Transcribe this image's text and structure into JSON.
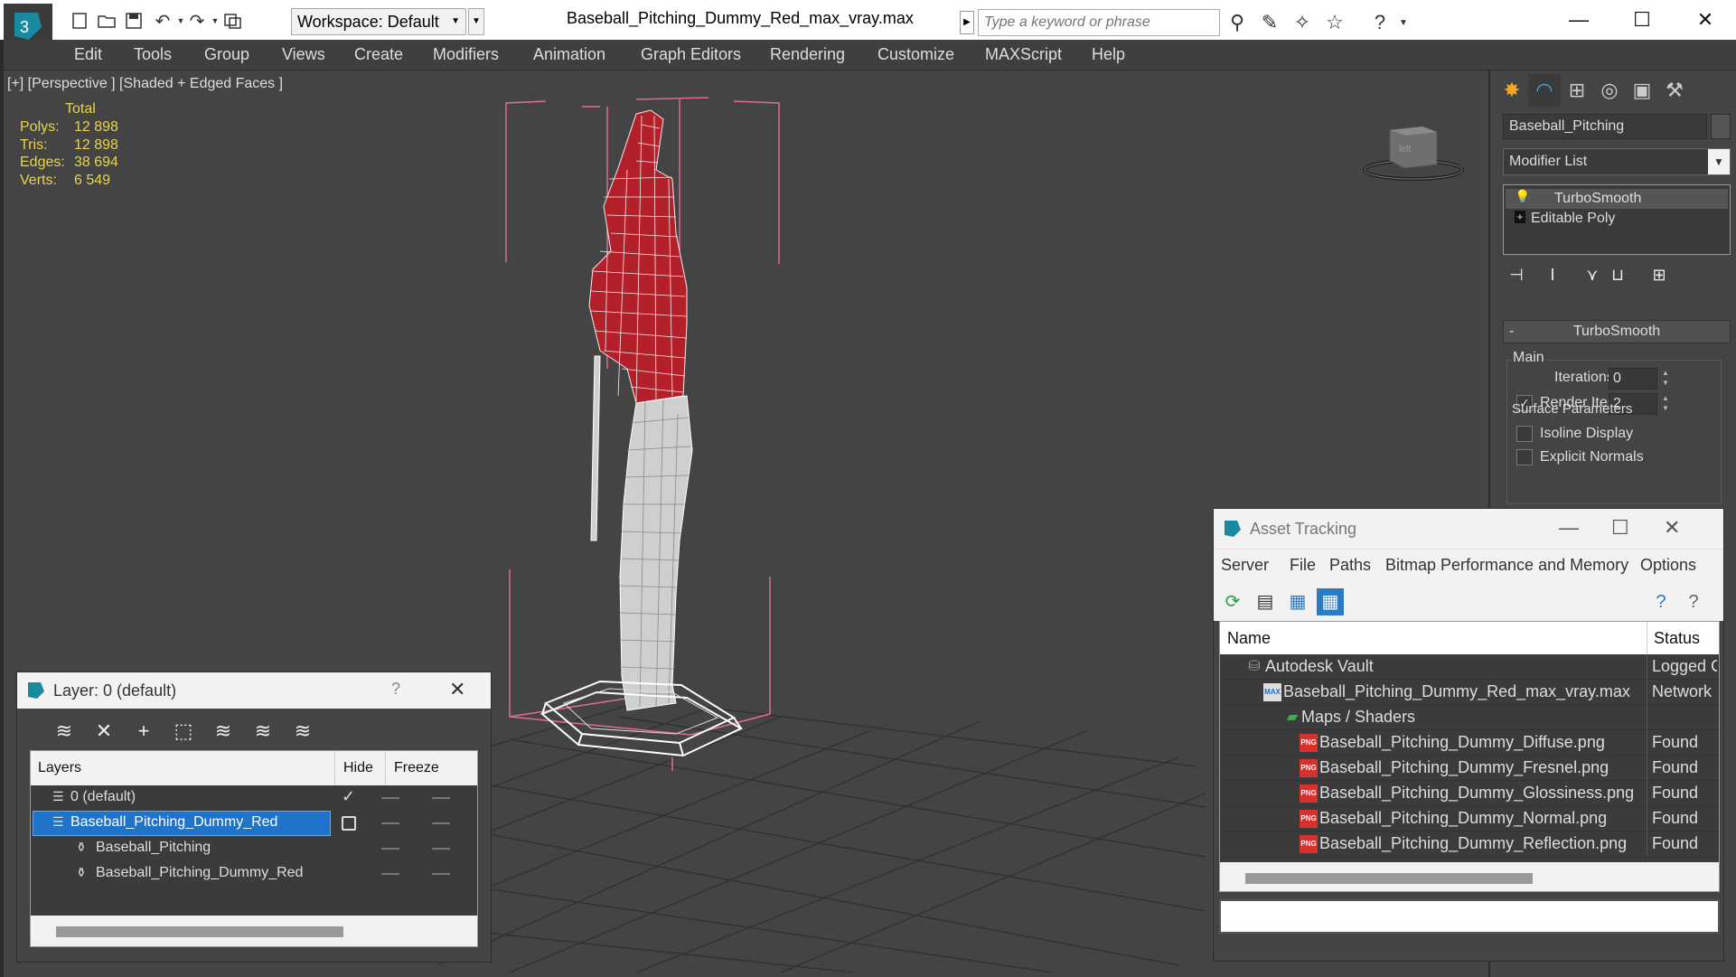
{
  "titlebar": {
    "workspace": "Workspace: Default",
    "window_title": "Baseball_Pitching_Dummy_Red_max_vray.max",
    "search_placeholder": "Type a keyword or phrase"
  },
  "menu": [
    "Edit",
    "Tools",
    "Group",
    "Views",
    "Create",
    "Modifiers",
    "Animation",
    "Graph Editors",
    "Rendering",
    "Customize",
    "MAXScript",
    "Help"
  ],
  "viewport": {
    "label": "[+] [Perspective ] [Shaded + Edged Faces ]",
    "viewcube_text": "left",
    "stats": {
      "header": "Total",
      "rows": [
        {
          "key": "Polys:",
          "value": "12 898"
        },
        {
          "key": "Tris:",
          "value": "12 898"
        },
        {
          "key": "Edges:",
          "value": "38 694"
        },
        {
          "key": "Verts:",
          "value": "6 549"
        }
      ]
    }
  },
  "command_panel": {
    "object_name": "Baseball_Pitching",
    "modifier_list": "Modifier List",
    "stack": [
      "TurboSmooth",
      "Editable Poly"
    ],
    "rollout": {
      "title": "TurboSmooth",
      "group": "Main",
      "iterations_label": "Iterations:",
      "iterations_value": "0",
      "render_iters_label": "Render Iters:",
      "render_iters_value": "2",
      "isoline_label": "Isoline Display",
      "explicit_label": "Explicit Normals",
      "surface_label": "Surface Parameters"
    }
  },
  "layer_dialog": {
    "title": "Layer: 0 (default)",
    "help": "?",
    "columns": {
      "layers": "Layers",
      "hide": "Hide",
      "freeze": "Freeze"
    },
    "rows": [
      {
        "name": "0 (default)"
      },
      {
        "name": "Baseball_Pitching_Dummy_Red"
      },
      {
        "name": "Baseball_Pitching"
      },
      {
        "name": "Baseball_Pitching_Dummy_Red"
      }
    ]
  },
  "asset_dialog": {
    "title": "Asset Tracking",
    "menu": [
      "Server",
      "File",
      "Paths",
      "Bitmap Performance and Memory",
      "Options"
    ],
    "columns": {
      "name": "Name",
      "status": "Status"
    },
    "rows": [
      {
        "name": "Autodesk Vault",
        "status": "Logged C"
      },
      {
        "name": "Baseball_Pitching_Dummy_Red_max_vray.max",
        "status": "Network"
      },
      {
        "name": "Maps / Shaders",
        "status": ""
      },
      {
        "name": "Baseball_Pitching_Dummy_Diffuse.png",
        "status": "Found"
      },
      {
        "name": "Baseball_Pitching_Dummy_Fresnel.png",
        "status": "Found"
      },
      {
        "name": "Baseball_Pitching_Dummy_Glossiness.png",
        "status": "Found"
      },
      {
        "name": "Baseball_Pitching_Dummy_Normal.png",
        "status": "Found"
      },
      {
        "name": "Baseball_Pitching_Dummy_Reflection.png",
        "status": "Found"
      }
    ]
  },
  "colors": {
    "stats_text": "#e8d44d",
    "selection_blue": "#1f74c9",
    "wire_red": "#b3202a",
    "bbox_pink": "#e06d8f"
  }
}
